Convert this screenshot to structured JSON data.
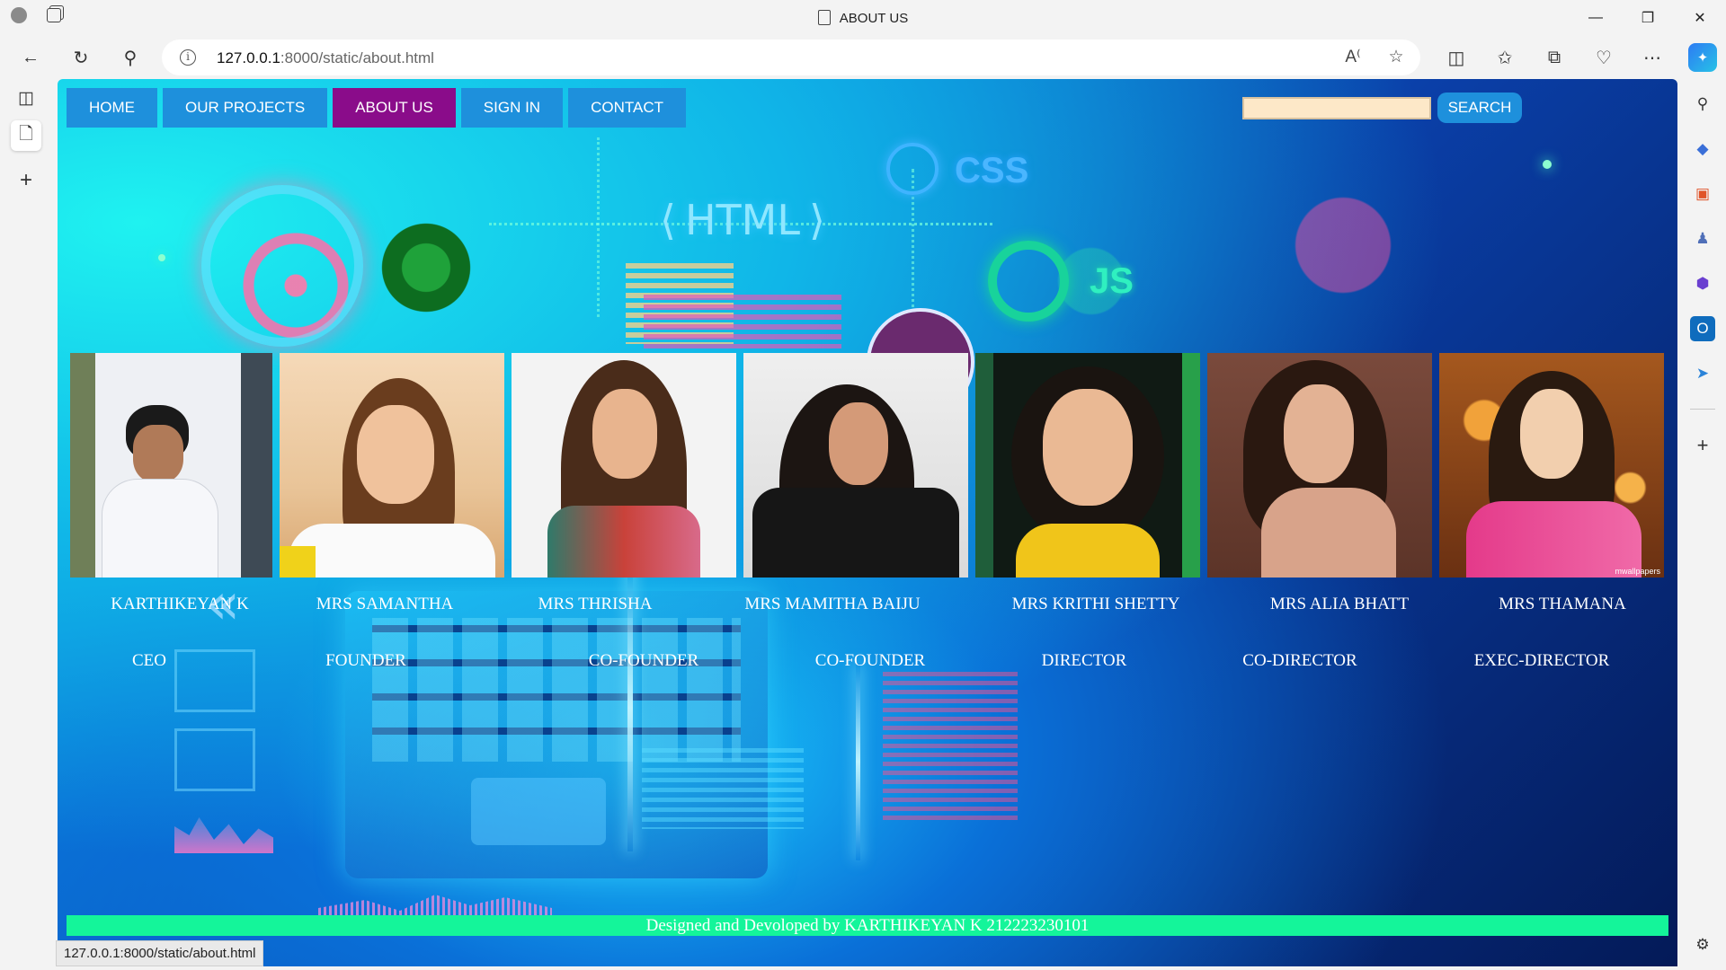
{
  "browser": {
    "tab_title": "ABOUT US",
    "url_host": "127.0.0.1",
    "url_rest": ":8000/static/about.html",
    "status_url": "127.0.0.1:8000/static/about.html"
  },
  "nav": {
    "items": [
      "HOME",
      "OUR PROJECTS",
      "ABOUT US",
      "SIGN IN",
      "CONTACT"
    ],
    "active": "ABOUT US",
    "search_placeholder": "",
    "search_label": "SEARCH"
  },
  "background_text": {
    "html": "HTML",
    "css": "CSS",
    "js": "JS"
  },
  "team": [
    {
      "name": "KARTHIKEYAN K",
      "role": "CEO"
    },
    {
      "name": "MRS SAMANTHA",
      "role": "FOUNDER"
    },
    {
      "name": "MRS THRISHA",
      "role": "CO-FOUNDER"
    },
    {
      "name": "MRS MAMITHA BAIJU",
      "role": "CO-FOUNDER"
    },
    {
      "name": "MRS KRITHI SHETTY",
      "role": "DIRECTOR"
    },
    {
      "name": "MRS ALIA BHATT",
      "role": "CO-DIRECTOR"
    },
    {
      "name": "MRS THAMANA",
      "role": "EXEC-DIRECTOR"
    }
  ],
  "photo_watermark": "mwallpapers",
  "footer": {
    "text": "Designed and Devoloped by KARTHIKEYAN K 212223230101"
  },
  "colors": {
    "nav_button": "#1e90dc",
    "nav_active": "#8a0c8a",
    "footer_bar": "#14f59a",
    "search_input": "#fde8c8"
  }
}
